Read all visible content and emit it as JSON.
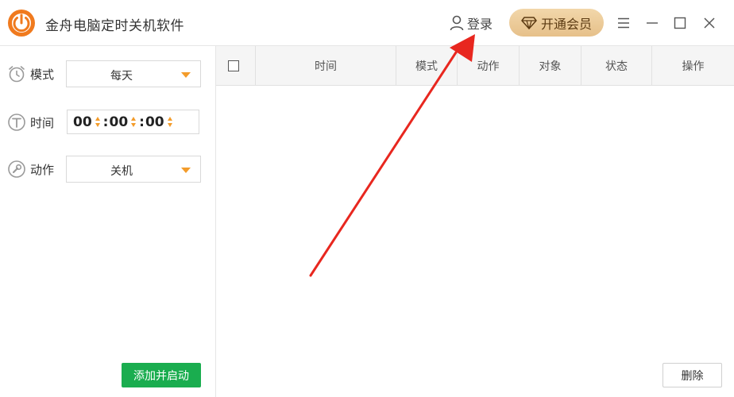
{
  "app": {
    "title": "金舟电脑定时关机软件",
    "login_label": "登录",
    "vip_label": "开通会员"
  },
  "icons": {
    "logo": "power-logo-icon",
    "login": "user-icon",
    "vip": "diamond-icon",
    "menu": "hamburger-menu-icon",
    "minimize": "minimize-icon",
    "maximize": "maximize-icon",
    "close": "close-icon"
  },
  "form": {
    "mode_label": "模式",
    "mode_value": "每天",
    "time_label": "时间",
    "time_hour": "00",
    "time_minute": "00",
    "time_second": "00",
    "action_label": "动作",
    "action_value": "关机",
    "add_button": "添加并启动"
  },
  "table": {
    "columns": [
      "时间",
      "模式",
      "动作",
      "对象",
      "状态",
      "操作"
    ],
    "rows": [],
    "delete_button": "删除"
  },
  "colors": {
    "accent_orange": "#f39c2b",
    "start_green": "#1aad4f",
    "vip_gold": "#e6c08a",
    "annotation_red": "#e8271f"
  }
}
